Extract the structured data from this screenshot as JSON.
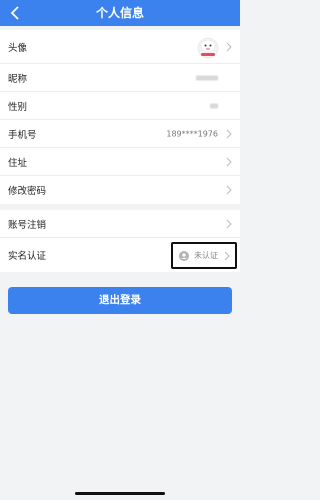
{
  "header": {
    "title": "个人信息"
  },
  "profile": {
    "avatar_label": "头像",
    "nickname_label": "昵称",
    "gender_label": "性别",
    "phone_label": "手机号",
    "phone_value": "189****1976",
    "address_label": "住址",
    "password_label": "修改密码"
  },
  "account": {
    "cancel_label": "账号注销",
    "realname_label": "实名认证",
    "realname_status": "未认证"
  },
  "logout_label": "退出登录",
  "colors": {
    "accent": "#3b82ee",
    "background": "#f2f3f5"
  }
}
